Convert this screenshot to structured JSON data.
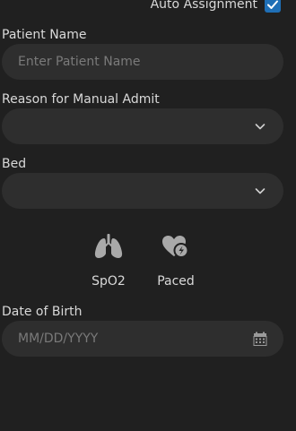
{
  "auto_assignment": {
    "label": "Auto Assignment",
    "checked": true
  },
  "patient_name": {
    "label": "Patient Name",
    "placeholder": "Enter Patient Name",
    "value": ""
  },
  "reason": {
    "label": "Reason for Manual Admit",
    "value": ""
  },
  "bed": {
    "label": "Bed",
    "value": ""
  },
  "flags": [
    {
      "label": "SpO2",
      "icon": "lungs-icon"
    },
    {
      "label": "Paced",
      "icon": "heart-pacer-icon"
    }
  ],
  "dob": {
    "label": "Date of Birth",
    "placeholder": "MM/DD/YYYY",
    "value": ""
  },
  "colors": {
    "background": "#202020",
    "field": "#2e2e2e",
    "checkbox": "#1f6fb6",
    "icon": "#a9a9a9"
  }
}
